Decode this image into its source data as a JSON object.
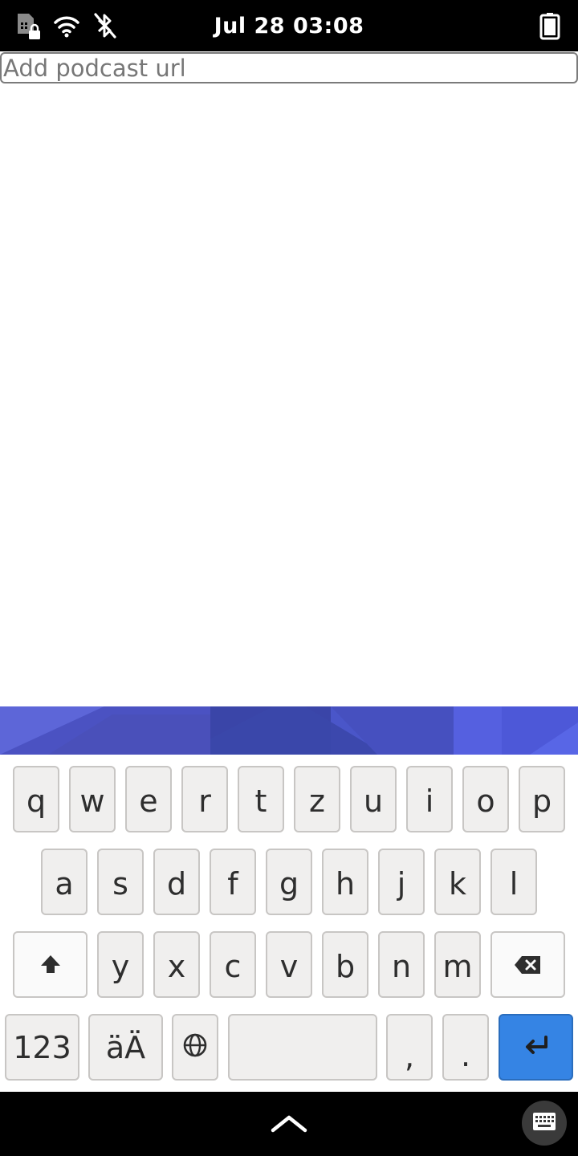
{
  "status_bar": {
    "clock": "Jul 28  03:08",
    "icons": [
      "sim-locked-icon",
      "wifi-icon",
      "bluetooth-disabled-icon",
      "battery-icon"
    ]
  },
  "url_input": {
    "placeholder": "Add podcast url",
    "value": ""
  },
  "keyboard": {
    "row1": [
      "q",
      "w",
      "e",
      "r",
      "t",
      "z",
      "u",
      "i",
      "o",
      "p"
    ],
    "row2": [
      "a",
      "s",
      "d",
      "f",
      "g",
      "h",
      "j",
      "k",
      "l"
    ],
    "row3": [
      "y",
      "x",
      "c",
      "v",
      "b",
      "n",
      "m"
    ],
    "shift_icon": "shift-arrow-icon",
    "backspace_icon": "backspace-icon",
    "numbers_label": "123",
    "accents_label": "äÄ",
    "globe_icon": "globe-icon",
    "comma_label": ",",
    "period_label": ".",
    "enter_icon": "enter-return-icon",
    "enter_color": "#3584e4"
  },
  "nav_bar": {
    "home_icon": "chevron-up-icon",
    "keyboard_toggle_icon": "keyboard-icon"
  }
}
